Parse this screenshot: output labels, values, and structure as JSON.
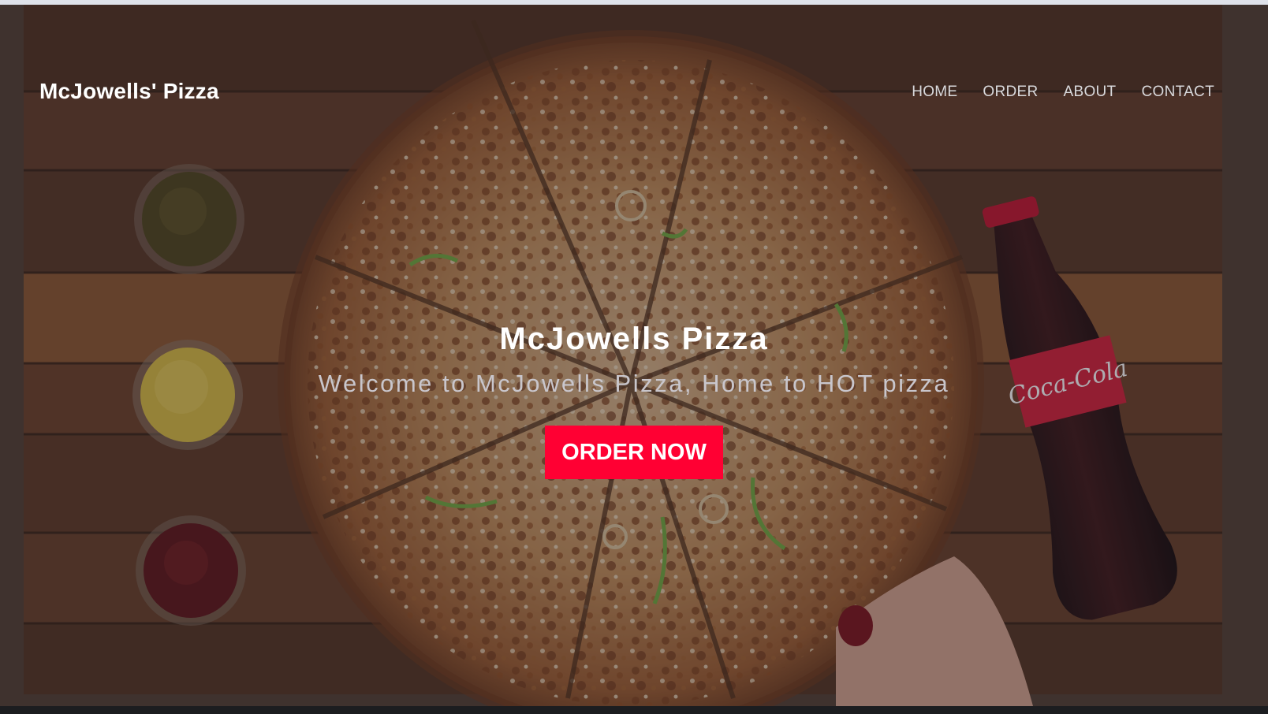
{
  "navbar": {
    "brand": "McJowells' Pizza",
    "links": [
      "HOME",
      "ORDER",
      "ABOUT",
      "CONTACT"
    ]
  },
  "hero": {
    "title": "McJowells Pizza",
    "subtitle": "Welcome to McJowells Pizza, Home to HOT pizza",
    "cta_label": "ORDER NOW",
    "bottle_logo": "Coca-Cola",
    "background_image": "top-down pizza on wooden board with sauce cups and cola bottle"
  },
  "colors": {
    "cta": "#ff0033",
    "brand_text": "#ffffff",
    "nav_text": "#d9d9dc",
    "subtitle_text": "#c9c6cc",
    "board_wood": "#5a3621",
    "overlay": "rgba(40,36,48,0.38)"
  }
}
